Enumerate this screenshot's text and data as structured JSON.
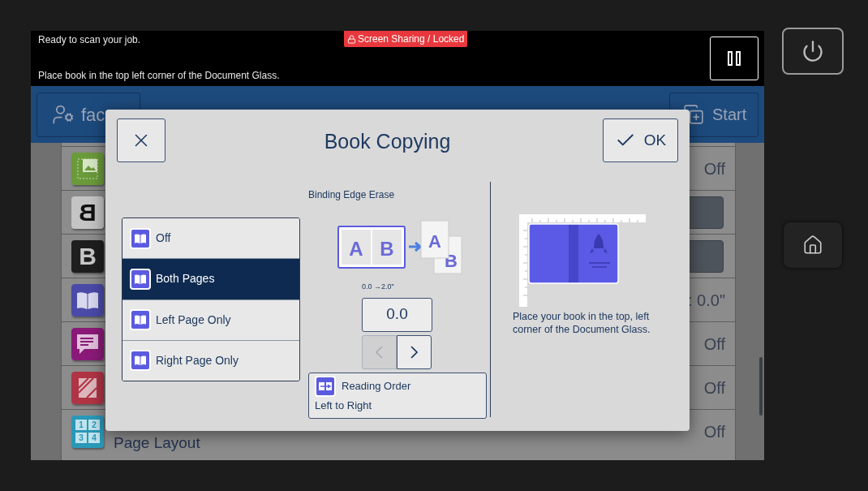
{
  "status_bar": {
    "message": "Ready to scan your job.",
    "instruction": "Place book in the top left corner of the Document Glass.",
    "badge": "Screen Sharing / Locked"
  },
  "header": {
    "user_button": "fac",
    "start_button": "Start"
  },
  "feature_list": {
    "rows": [
      {
        "kind": "value",
        "color": "#6a9a3a",
        "value": "Off"
      },
      {
        "kind": "control",
        "color": "#c4c4c4",
        "glyph": "B",
        "mirrored": true
      },
      {
        "kind": "control",
        "color": "#1e1e1e",
        "glyph": "B",
        "mirrored": false
      },
      {
        "kind": "value",
        "color": "#4a4aa8",
        "value": ": 0.0\""
      },
      {
        "kind": "value",
        "color": "#8a1a78",
        "value": "Off"
      },
      {
        "kind": "value",
        "color": "#b03444",
        "value": "Off"
      },
      {
        "kind": "value",
        "color": "#2a98b8",
        "glyphs": [
          "1",
          "2",
          "3",
          "4"
        ],
        "label": "Page Layout",
        "value": "Off"
      }
    ]
  },
  "dialog": {
    "title": "Book Copying",
    "ok_button": "OK",
    "options": [
      {
        "label": "Off",
        "selected": false
      },
      {
        "label": "Both Pages",
        "selected": true
      },
      {
        "label": "Left Page Only",
        "selected": false
      },
      {
        "label": "Right Page Only",
        "selected": false
      }
    ],
    "binding_edge_erase": {
      "label": "Binding Edge Erase",
      "diagram": {
        "book_pages": [
          "A",
          "B"
        ],
        "output_pages": [
          "A",
          "B"
        ]
      },
      "range": "0.0 →2.0\"",
      "value": "0.0",
      "decrease_disabled": true,
      "increase_disabled": false
    },
    "reading_order": {
      "label": "Reading Order",
      "value": "Left to Right"
    },
    "hint": "Place your book in the top, left corner of the Document Glass."
  }
}
